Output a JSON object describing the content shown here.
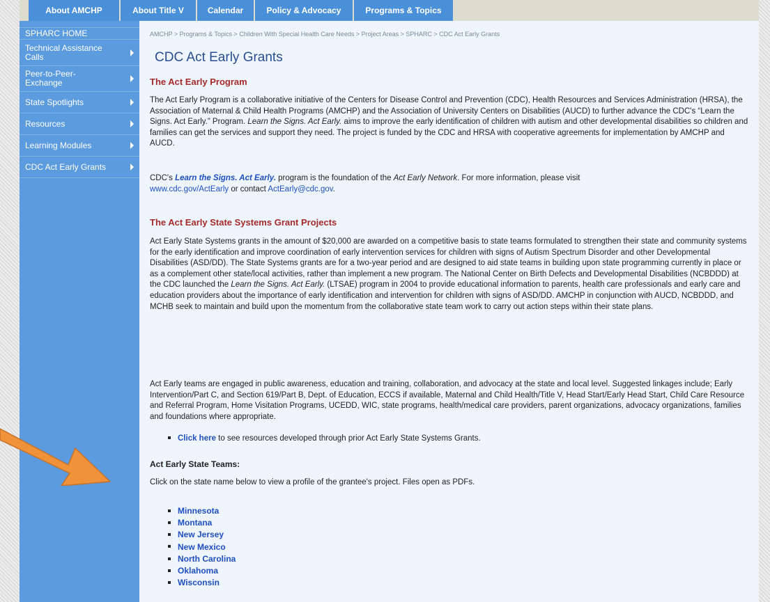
{
  "nav": {
    "tabs": [
      {
        "label": "About AMCHP"
      },
      {
        "label": "About Title V"
      },
      {
        "label": "Calendar"
      },
      {
        "label": "Policy & Advocacy"
      },
      {
        "label": "Programs & Topics"
      }
    ]
  },
  "sidebar": {
    "items": [
      {
        "label": "SPHARC HOME"
      },
      {
        "label": "Technical Assistance Calls"
      },
      {
        "label": "Peer-to-Peer-Exchange"
      },
      {
        "label": "State Spotlights"
      },
      {
        "label": "Resources"
      },
      {
        "label": "Learning Modules"
      },
      {
        "label": "CDC Act Early Grants"
      }
    ]
  },
  "breadcrumb": [
    "AMCHP",
    "Programs & Topics",
    "Children With Special Health Care Needs",
    "Project Areas",
    "SPHARC",
    "CDC Act Early Grants"
  ],
  "breadcrumb_separator": " > ",
  "page": {
    "title": "CDC Act Early Grants",
    "section1_heading": "The Act Early Program",
    "p1_a": "The Act Early Program is a collaborative initiative of the Centers for Disease Control and Prevention (CDC), Health Resources and Services Administration (HRSA), the Association of Maternal & Child Health Programs (AMCHP) and the Association of University Centers on Disabilities (AUCD) to further advance the CDC's “Learn the Signs. Act Early.” Program. ",
    "p1_em": "Learn the Signs. Act Early.",
    "p1_b": " aims to improve the early identification of children with autism and other developmental disabilities so children and families can get the services and support they need. The project is funded by the CDC and HRSA with cooperative agreements for implementation by AMCHP and AUCD.",
    "p2_a": "CDC's ",
    "p2_link": "Learn the Signs. Act Early.",
    "p2_b": " program is the foundation of the ",
    "p2_em": "Act Early Network",
    "p2_c": ". For more information, please visit ",
    "p2_url": "www.cdc.gov/ActEarly",
    "p2_d": " or contact ",
    "p2_email": "ActEarly@cdc.gov",
    "p2_e": ".",
    "section2_heading": "The Act Early State Systems Grant Projects",
    "p3_a": "Act Early State Systems grants in the amount of $20,000 are awarded on a competitive basis to state teams formulated to strengthen their state and community systems for the early identification and improve coordination of early intervention services for children with signs of Autism Spectrum Disorder and other Developmental Disabilities (ASD/DD). The State Systems grants are for a two-year period and are designed to aid state teams in building upon state programming currently in place or as a complement other state/local activities, rather than implement a new program. The National Center on Birth Defects and Developmental Disabilities (NCBDDD) at the CDC launched the ",
    "p3_em": "Learn the Signs. Act Early.",
    "p3_b": " (LTSAE) program in 2004 to provide educational information to parents, health care professionals and early care and education providers about the importance of early identification and intervention for children with signs of ASD/DD. AMCHP in conjunction with AUCD, NCBDDD, and MCHB seek to maintain and build upon the momentum from the collaborative state team work to carry out action steps within their state plans.",
    "p4": "Act Early teams are engaged in public awareness, education and training, collaboration, and advocacy at the state and local level. Suggested linkages include; Early Intervention/Part C, and Section 619/Part B, Dept. of Education, ECCS if available, Maternal and Child Health/Title V, Head Start/Early Head Start, Child Care Resource and Referral Program, Home Visitation Programs, UCEDD, WIC, state programs, health/medical care providers, parent organizations, advocacy organizations, families and foundations where appropriate.",
    "bullet_link": "Click here",
    "bullet_text": " to see resources developed through prior Act Early State Systems Grants.",
    "teams_heading": "Act Early State Teams:",
    "teams_intro": "Click on the state name below to view a profile of the grantee's project. Files open as PDFs.",
    "states": [
      "Minnesota",
      "Montana",
      "New Jersey",
      "New Mexico",
      "North Carolina",
      "Oklahoma",
      "Wisconsin"
    ]
  },
  "colors": {
    "tab_bg": "#4a90d9",
    "sidebar_bg": "#5b9bde",
    "content_bg": "#eef5fc",
    "heading_red": "#a52a2a",
    "link_blue": "#1f4fbf",
    "arrow_orange": "#f0923a"
  }
}
